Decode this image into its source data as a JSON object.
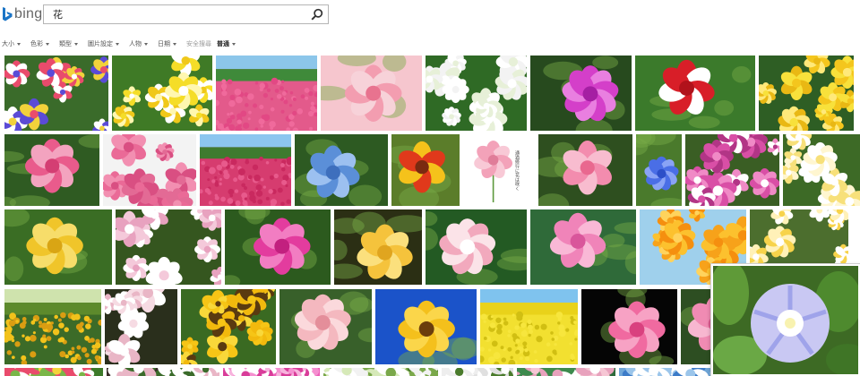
{
  "header": {
    "logo_icon": "bing-logo-icon",
    "logo_text": "bing",
    "search_query": "花",
    "search_icon": "search-icon"
  },
  "filters": [
    {
      "label": "大小",
      "dropdown": true
    },
    {
      "label": "色彩",
      "dropdown": true
    },
    {
      "label": "類型",
      "dropdown": true
    },
    {
      "label": "圖片設定",
      "dropdown": true
    },
    {
      "label": "人物",
      "dropdown": true
    },
    {
      "label": "日期",
      "dropdown": true
    }
  ],
  "safe_search": {
    "label": "安全搜尋",
    "value": "普通"
  },
  "theme": {
    "accent": "#1a74c6",
    "filter_text": "#555555"
  },
  "results": [
    {
      "name": "result-mixed-flowers",
      "row": 0,
      "bg": "#3a6b2a",
      "kind": "multi",
      "colors": [
        "#e94b6c",
        "#ffffff",
        "#5b4bd6",
        "#f2d23b"
      ]
    },
    {
      "name": "result-yellow-white-flowers",
      "row": 0,
      "bg": "#3f7a26",
      "kind": "multi",
      "colors": [
        "#f5dd28",
        "#ffffff",
        "#f0c81a",
        "#fff7b0"
      ]
    },
    {
      "name": "result-pink-field",
      "row": 0,
      "bg": "#e35a8b",
      "kind": "field",
      "colors": [
        "#8cc6ea",
        "#3f8a3a",
        "#f06a9c",
        "#e24884"
      ]
    },
    {
      "name": "result-pink-camellia",
      "row": 0,
      "bg": "#f6c6ce",
      "kind": "bloom",
      "colors": [
        "#f39db0",
        "#f7d2d9",
        "#e8738f"
      ]
    },
    {
      "name": "result-white-blossoms",
      "row": 0,
      "bg": "#2f6a25",
      "kind": "multi",
      "colors": [
        "#ffffff",
        "#f3f3f3",
        "#e7f0d8",
        "#ffffff"
      ]
    },
    {
      "name": "result-purple-orchid",
      "row": 0,
      "bg": "#274a1e",
      "kind": "bloom",
      "colors": [
        "#d43fc9",
        "#e97fe0",
        "#a51fa3"
      ]
    },
    {
      "name": "result-red-tulips",
      "row": 0,
      "bg": "#3b7a2b",
      "kind": "bloom",
      "colors": [
        "#d81e28",
        "#ffffff",
        "#b1121b"
      ]
    },
    {
      "name": "result-yellow-flowers",
      "row": 0,
      "bg": "#2e5e24",
      "kind": "multi",
      "colors": [
        "#f8e13b",
        "#f4c61d",
        "#ffe97a",
        "#e9b814"
      ]
    },
    {
      "name": "result-pink-peony",
      "row": 1,
      "bg": "#2f5b22",
      "kind": "bloom",
      "colors": [
        "#e95b8c",
        "#f3a3bf",
        "#d43e73"
      ]
    },
    {
      "name": "result-pink-roses",
      "row": 1,
      "bg": "#f3f3f3",
      "kind": "multi",
      "colors": [
        "#ea6a97",
        "#f28fb1",
        "#d94f82",
        "#e36a95"
      ]
    },
    {
      "name": "result-pink-park",
      "row": 1,
      "bg": "#d63c6f",
      "kind": "field",
      "colors": [
        "#8cc6ef",
        "#3e7b2f",
        "#e85a8c",
        "#c9295f"
      ]
    },
    {
      "name": "result-blue-hydrangea",
      "row": 1,
      "bg": "#2d5a22",
      "kind": "bloom",
      "colors": [
        "#5b8fd8",
        "#9cc0f0",
        "#3e6fbd"
      ]
    },
    {
      "name": "result-gaillardia",
      "row": 1,
      "bg": "#5b7d2a",
      "kind": "bloom",
      "colors": [
        "#f5c21b",
        "#e0391b",
        "#7a2a10"
      ]
    },
    {
      "name": "result-pink-gerbera-card",
      "row": 1,
      "bg": "#ffffff",
      "kind": "card",
      "colors": [
        "#f3a2b9",
        "#f8c9d6",
        "#e07d99"
      ],
      "caption": "通過修行に花は咲く"
    },
    {
      "name": "result-pink-gerbera",
      "row": 1,
      "bg": "#2e4f1f",
      "kind": "bloom",
      "colors": [
        "#f38cae",
        "#f8bccf",
        "#e9688f"
      ]
    },
    {
      "name": "result-blue-flower",
      "row": 1,
      "bg": "#4a7a2c",
      "kind": "bloom",
      "colors": [
        "#4a6ee6",
        "#8aa3f5",
        "#2c4fc8"
      ]
    },
    {
      "name": "result-cosmos",
      "row": 1,
      "bg": "#3a5e24",
      "kind": "multi",
      "colors": [
        "#d94fa6",
        "#f08ac6",
        "#ffffff",
        "#b23586"
      ]
    },
    {
      "name": "result-white-plumeria",
      "row": 1,
      "bg": "#3d6a26",
      "kind": "multi",
      "colors": [
        "#ffffff",
        "#fff6d0",
        "#f7e07a",
        "#ffffff"
      ]
    },
    {
      "name": "result-yellow-lilies-green",
      "row": 2,
      "bg": "#3a6d24",
      "kind": "bloom",
      "colors": [
        "#f0c52a",
        "#f7dd6a",
        "#d9a514"
      ]
    },
    {
      "name": "result-pink-white-blossoms",
      "row": 2,
      "bg": "#35561f",
      "kind": "multi",
      "colors": [
        "#ffffff",
        "#f4c9da",
        "#e8a2bf",
        "#ffffff"
      ]
    },
    {
      "name": "result-pink-rose-tree",
      "row": 2,
      "bg": "#2c5a1e",
      "kind": "bloom",
      "colors": [
        "#e33c9e",
        "#f27dc2",
        "#c2207f"
      ]
    },
    {
      "name": "result-yellow-rose",
      "row": 2,
      "bg": "#2b2f14",
      "kind": "bloom",
      "colors": [
        "#f5c33c",
        "#fbe07d",
        "#e0a51f"
      ]
    },
    {
      "name": "result-white-pink-lotus",
      "row": 2,
      "bg": "#235a23",
      "kind": "bloom",
      "colors": [
        "#fbe3e8",
        "#f2a9bd",
        "#ffffff"
      ]
    },
    {
      "name": "result-pink-waterlily",
      "row": 2,
      "bg": "#2f6a39",
      "kind": "bloom",
      "colors": [
        "#f084b9",
        "#f9b8d6",
        "#d9569b"
      ]
    },
    {
      "name": "result-orange-lilies",
      "row": 2,
      "bg": "#9fd0ec",
      "kind": "multi",
      "colors": [
        "#f7a21a",
        "#fcc12e",
        "#f58f0f",
        "#ffd35c"
      ]
    },
    {
      "name": "result-white-yellow-plumeria",
      "row": 2,
      "bg": "#4c6e2e",
      "kind": "multi",
      "colors": [
        "#ffffff",
        "#fff1b8",
        "#f7d34b",
        "#ffffff"
      ]
    },
    {
      "name": "result-sunflower-field",
      "row": 3,
      "bg": "#3c6b28",
      "kind": "field",
      "colors": [
        "#cfe3ad",
        "#5d8a2c",
        "#f2c21b",
        "#d99d12"
      ]
    },
    {
      "name": "result-white-azalea",
      "row": 3,
      "bg": "#2a2f1c",
      "kind": "multi",
      "colors": [
        "#ffffff",
        "#f6dbe3",
        "#e9b6c6",
        "#ffffff"
      ]
    },
    {
      "name": "result-sunflowers",
      "row": 3,
      "bg": "#3a6a22",
      "kind": "multi",
      "colors": [
        "#f6c516",
        "#f9d83a",
        "#5a3a10",
        "#f2b90d"
      ]
    },
    {
      "name": "result-pink-rose",
      "row": 3,
      "bg": "#38602a",
      "kind": "bloom",
      "colors": [
        "#f4b8bf",
        "#fbd9dc",
        "#e48e9a"
      ]
    },
    {
      "name": "result-sunflower-blue-sky",
      "row": 3,
      "bg": "#1b53c9",
      "kind": "bloom",
      "colors": [
        "#f4c01c",
        "#fbd64a",
        "#6b3d0c"
      ]
    },
    {
      "name": "result-rapeseed-field",
      "row": 3,
      "bg": "#f2e030",
      "kind": "field",
      "colors": [
        "#7fc3ee",
        "#e9d21a",
        "#f7e63d",
        "#d1bf12"
      ]
    },
    {
      "name": "result-pink-camellia-black",
      "row": 3,
      "bg": "#050505",
      "kind": "bloom",
      "colors": [
        "#f06aa0",
        "#f7a2c4",
        "#d9417f"
      ]
    },
    {
      "name": "result-pink-rose-partial",
      "row": 3,
      "bg": "#2d4e22",
      "kind": "bloom",
      "colors": [
        "#f08bb3",
        "#f7b7d0",
        "#de5e92"
      ]
    },
    {
      "name": "result-row5-1",
      "row": 4,
      "bg": "#3d7a2a",
      "kind": "multi",
      "colors": [
        "#f4d33a",
        "#ffffff",
        "#e94b6c",
        "#7ab648"
      ]
    },
    {
      "name": "result-row5-2",
      "row": 4,
      "bg": "#3a2c2a",
      "kind": "multi",
      "colors": [
        "#ffffff",
        "#e9b6c6",
        "#3b6b2b",
        "#ffffff"
      ]
    },
    {
      "name": "result-row5-3",
      "row": 4,
      "bg": "#ec5fb8",
      "kind": "multi",
      "colors": [
        "#f58fd0",
        "#ffffff",
        "#d93d9a",
        "#f7b3dd"
      ]
    },
    {
      "name": "result-row5-4",
      "row": 4,
      "bg": "#4a7b2c",
      "kind": "multi",
      "colors": [
        "#ffffff",
        "#d6e9b8",
        "#7aa84a",
        "#f2f2f2"
      ]
    },
    {
      "name": "result-row5-5",
      "row": 4,
      "bg": "#ffffff",
      "kind": "multi",
      "colors": [
        "#eeeeee",
        "#4a7b2c",
        "#e0e0e0",
        "#ffffff"
      ]
    },
    {
      "name": "result-row5-6",
      "row": 4,
      "bg": "#2d6a3b",
      "kind": "multi",
      "colors": [
        "#f6c6d4",
        "#ffffff",
        "#3d8a4d",
        "#e8a2bd"
      ]
    },
    {
      "name": "result-row5-7",
      "row": 4,
      "bg": "#6fa6d8",
      "kind": "multi",
      "colors": [
        "#ffffff",
        "#3c7bc8",
        "#9bc5ea",
        "#ffffff"
      ]
    }
  ],
  "hover_preview": {
    "name": "hover-preview-morning-glory",
    "bg": "#3d6a24",
    "colors": [
      "#c9c8f3",
      "#9fa3ea",
      "#ffffff",
      "#f8f2b0"
    ]
  }
}
